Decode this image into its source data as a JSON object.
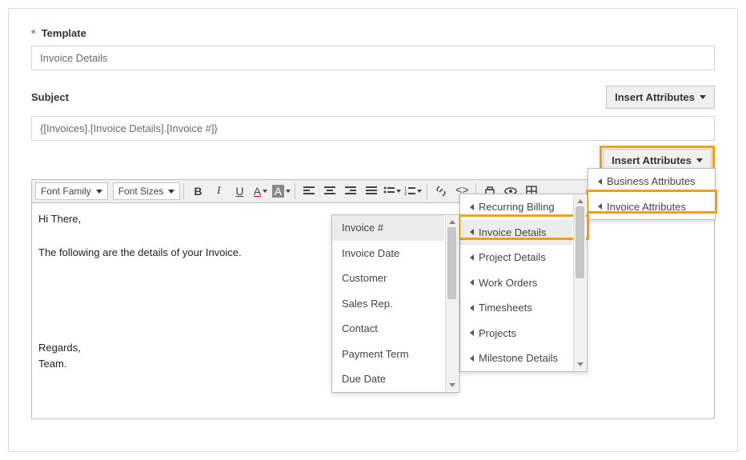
{
  "labels": {
    "template": "Template",
    "subject": "Subject"
  },
  "fields": {
    "template_value": "Invoice Details",
    "subject_value": "{[Invoices].[Invoice Details].[Invoice #]}"
  },
  "buttons": {
    "insert_attributes": "Insert Attributes"
  },
  "toolbar": {
    "font_family": "Font Family",
    "font_sizes": "Font Sizes"
  },
  "body": {
    "line1": "Hi There,",
    "line2": "The following are the details of your Invoice.",
    "line3": "Regards,",
    "line4": "Team."
  },
  "menus": {
    "level1": [
      {
        "label": "Business Attributes",
        "sub": true
      },
      {
        "label": "Invoice Attributes",
        "sub": true,
        "highlighted": true
      }
    ],
    "level2": [
      {
        "label": "Recurring Billing",
        "sub": true
      },
      {
        "label": "Invoice Details",
        "sub": true,
        "hover": true,
        "highlighted": true
      },
      {
        "label": "Project Details",
        "sub": true
      },
      {
        "label": "Work Orders",
        "sub": true
      },
      {
        "label": "Timesheets",
        "sub": true
      },
      {
        "label": "Projects",
        "sub": true
      },
      {
        "label": "Milestone Details",
        "sub": true
      }
    ],
    "level3": [
      {
        "label": "Invoice #",
        "hover": true
      },
      {
        "label": "Invoice Date"
      },
      {
        "label": "Customer"
      },
      {
        "label": "Sales Rep."
      },
      {
        "label": "Contact"
      },
      {
        "label": "Payment Term"
      },
      {
        "label": "Due Date"
      }
    ]
  }
}
